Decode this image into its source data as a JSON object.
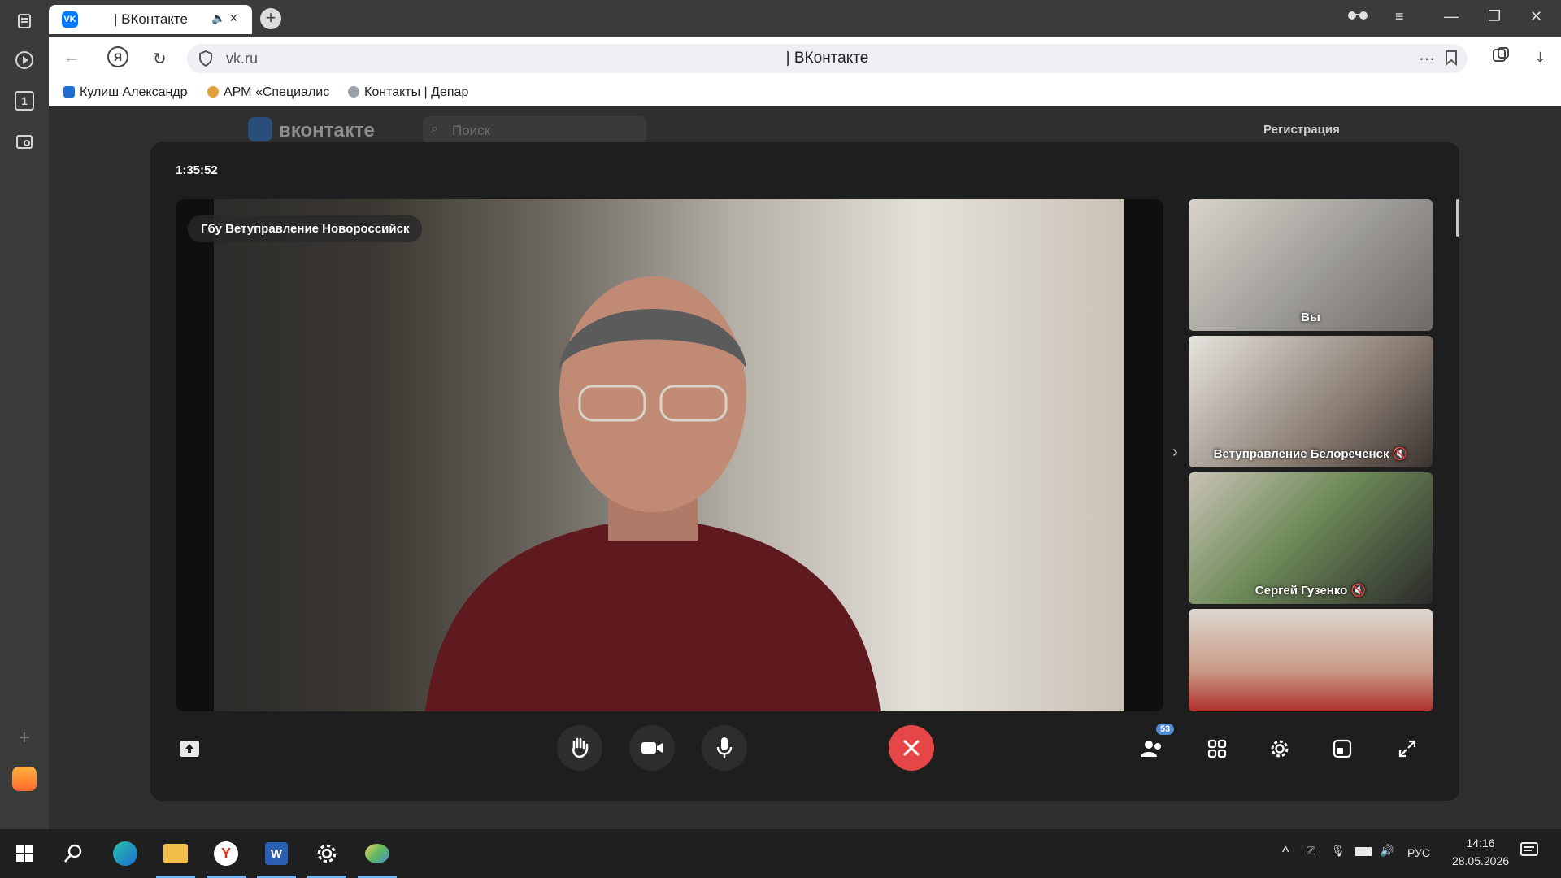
{
  "browser": {
    "tab_title": "| ВКонтакте",
    "tab_favicon_text": "VK",
    "url": "vk.ru",
    "page_title": "| ВКонтакте",
    "bookmarks": [
      {
        "label": "Кулиш Александр"
      },
      {
        "label": "АРМ «Специалис"
      },
      {
        "label": "Контакты | Депар"
      }
    ],
    "sidebar_badge": "1"
  },
  "vk_page": {
    "logo_text": "вконтакте",
    "search_placeholder": "Поиск",
    "register_label": "Регистрация"
  },
  "call": {
    "timer": "1:35:52",
    "main_participant": "Гбу Ветуправление Новороссийск",
    "participants": [
      {
        "name": "Вы",
        "muted": false
      },
      {
        "name": "Ветуправление Белореченск",
        "muted": true
      },
      {
        "name": "Сергей Гузенко",
        "muted": true
      },
      {
        "name": "",
        "muted": false
      }
    ],
    "participant_count": "53",
    "colors": {
      "end_call": "#e64646",
      "badge": "#4d8bd6"
    }
  },
  "taskbar": {
    "language": "РУС",
    "time": "14:16",
    "date": "28.05.2026"
  }
}
